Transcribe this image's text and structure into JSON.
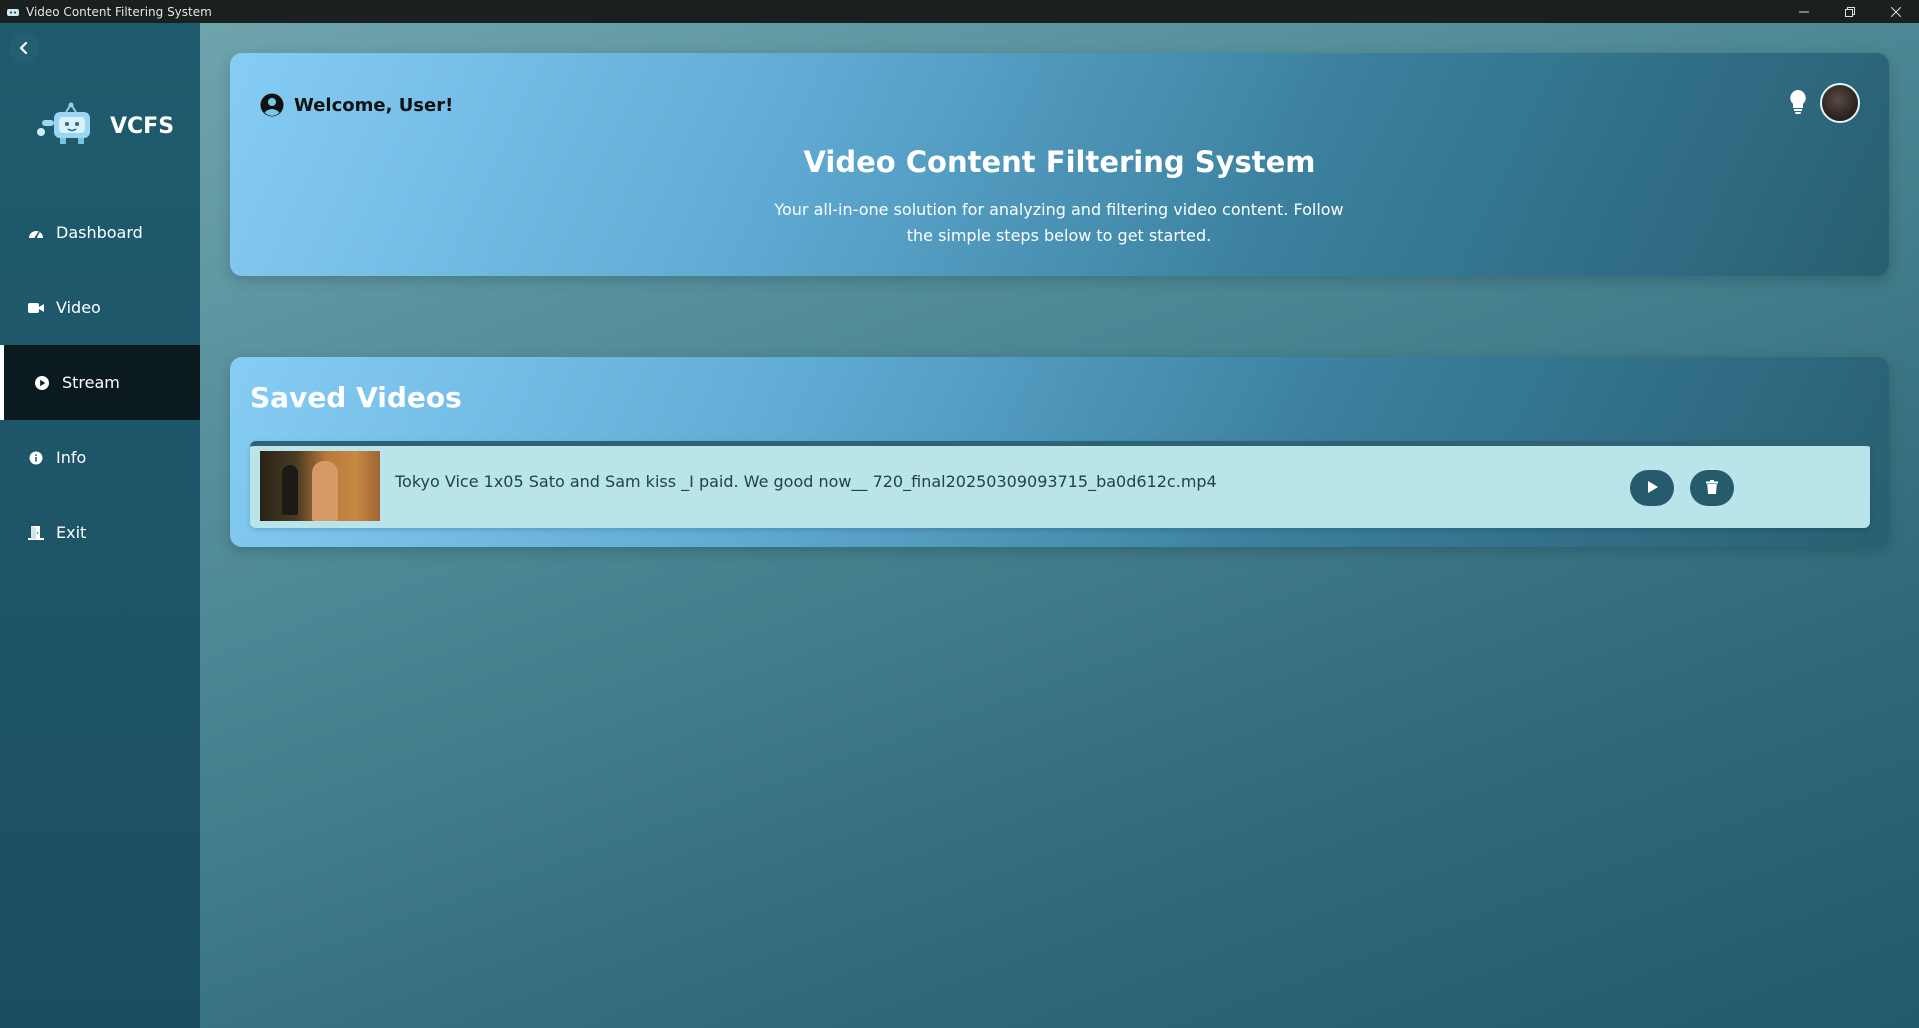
{
  "window": {
    "title": "Video Content Filtering System"
  },
  "sidebar": {
    "logo_text": "VCFS",
    "items": [
      {
        "label": "Dashboard",
        "icon": "dashboard-icon"
      },
      {
        "label": "Video",
        "icon": "video-camera-icon"
      },
      {
        "label": "Stream",
        "icon": "play-circle-icon",
        "active": true
      },
      {
        "label": "Info",
        "icon": "info-icon"
      },
      {
        "label": "Exit",
        "icon": "exit-door-icon"
      }
    ]
  },
  "hero": {
    "welcome": "Welcome, User!",
    "title": "Video Content Filtering System",
    "subtitle": "Your all-in-one solution for analyzing and filtering video content. Follow the simple steps below to get started."
  },
  "saved": {
    "title": "Saved Videos",
    "videos": [
      {
        "name": "Tokyo Vice 1x05 Sato and Sam kiss _I paid. We good now__ 720_final20250309093715_ba0d612c.mp4"
      }
    ]
  },
  "colors": {
    "sidebar_bg": "#1f5b6e",
    "active_nav_bg": "#0b1a1f",
    "card_gradient_start": "#86cdf5",
    "card_gradient_end": "#285f72",
    "video_row_bg": "#b8e4ea",
    "action_button_bg": "#255b6c"
  }
}
